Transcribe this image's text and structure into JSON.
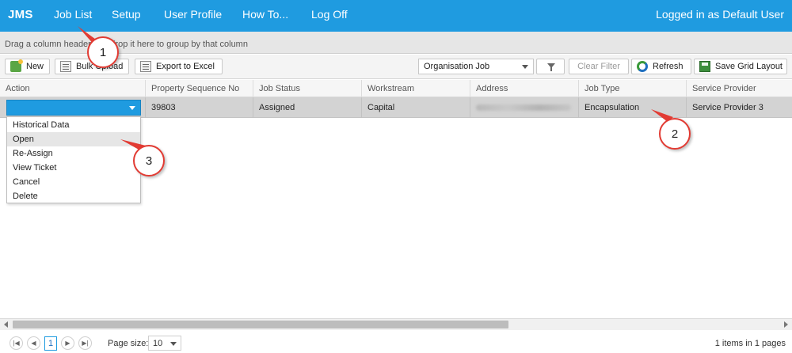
{
  "nav": {
    "brand": "JMS",
    "items": [
      "Job List",
      "Setup",
      "User Profile",
      "How To...",
      "Log Off"
    ],
    "login_status": "Logged in as Default User"
  },
  "group_panel": {
    "hint": "Drag a column header and drop it here to group by that column"
  },
  "toolbar": {
    "new_label": "New",
    "bulk_upload_label": "Bulk Upload",
    "export_label": "Export to Excel",
    "organisation_select": "Organisation Job",
    "clear_filter_label": "Clear Filter",
    "refresh_label": "Refresh",
    "save_layout_label": "Save Grid Layout"
  },
  "grid": {
    "columns": [
      "Action",
      "Property Sequence No",
      "Job Status",
      "Workstream",
      "Address",
      "Job Type",
      "Service Provider"
    ],
    "rows": [
      {
        "property_sequence_no": "39803",
        "job_status": "Assigned",
        "workstream": "Capital",
        "address": "",
        "job_type": "Encapsulation",
        "service_provider": "Service Provider 3"
      }
    ]
  },
  "action_menu": {
    "items": [
      "Historical Data",
      "Open",
      "Re-Assign",
      "View Ticket",
      "Cancel",
      "Delete"
    ],
    "hovered": "Open"
  },
  "callouts": [
    "1",
    "2",
    "3"
  ],
  "pager": {
    "current_page": "1",
    "page_size_label": "Page size:",
    "page_size": "10",
    "items_info": "1 items in 1 pages"
  },
  "colors": {
    "accent": "#1f9be0",
    "callout_border": "#e23b33",
    "row_selected": "#d3d3d3"
  }
}
